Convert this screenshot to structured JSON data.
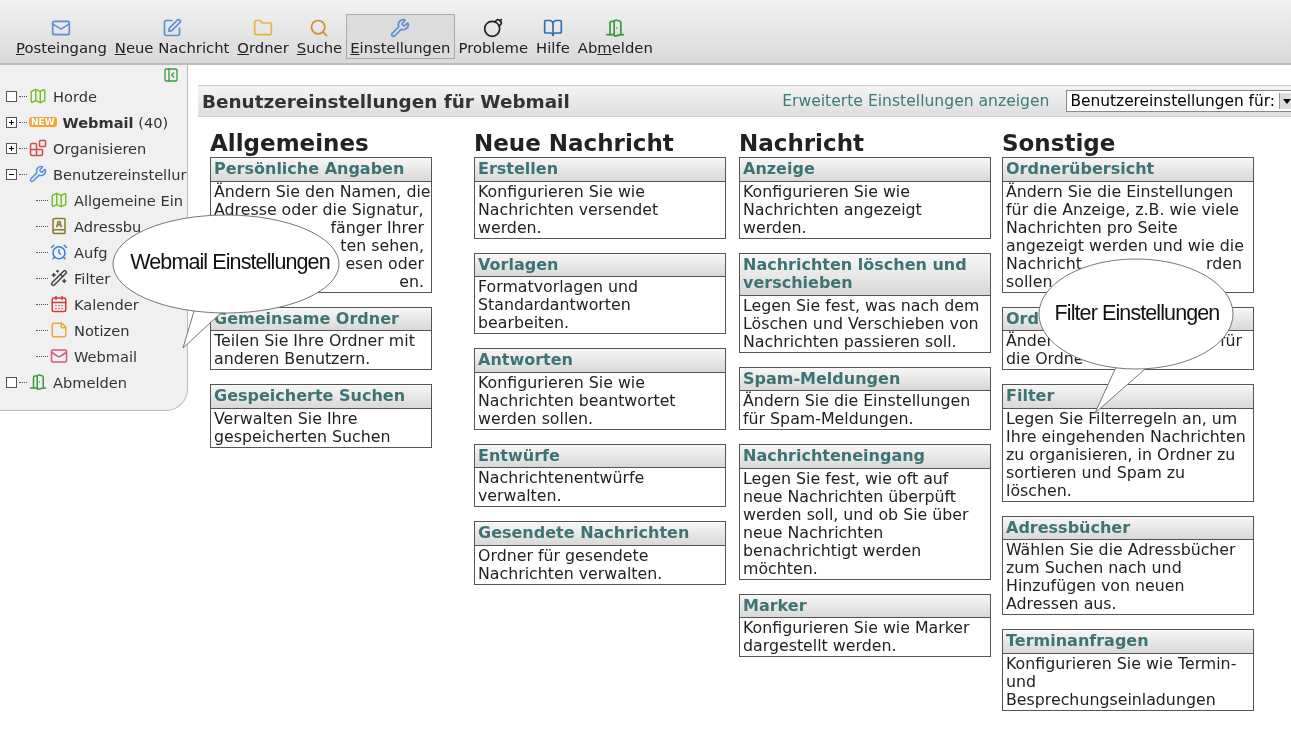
{
  "toolbar": [
    {
      "key": "P",
      "after": "osteingang",
      "selected": false
    },
    {
      "key": "N",
      "after": "eue Nachricht",
      "selected": false
    },
    {
      "key": "O",
      "after": "rdner",
      "selected": false
    },
    {
      "key": "S",
      "after": "uche",
      "selected": false
    },
    {
      "key": "E",
      "after": "instellungen",
      "selected": true
    },
    {
      "before": "Probleme",
      "selected": false
    },
    {
      "before": "Hilfe",
      "selected": false
    },
    {
      "before": "Ab",
      "key": "m",
      "after": "elden",
      "selected": false
    }
  ],
  "sidebar": {
    "items": [
      {
        "label": "Horde",
        "kind": "leaf"
      },
      {
        "badge": "NEW",
        "label": "**Webmail** (40)",
        "kind": "folder",
        "expanded": false
      },
      {
        "label": "Organisieren",
        "kind": "folder",
        "expanded": false
      },
      {
        "label": "Benutzereinstellur",
        "kind": "folder",
        "expanded": true,
        "children": [
          {
            "label": "Allgemeine Ein"
          },
          {
            "label": "Adressbu"
          },
          {
            "label": "Aufg"
          },
          {
            "label": "Filter"
          },
          {
            "label": "Kalender"
          },
          {
            "label": "Notizen"
          },
          {
            "label": "Webmail"
          }
        ]
      },
      {
        "label": "Abmelden",
        "kind": "leaf"
      }
    ]
  },
  "header": {
    "title": "Benutzereinstellungen für Webmail",
    "link": "Erweiterte Einstellungen anzeigen",
    "select": "Benutzereinstellungen für:"
  },
  "columns": [
    {
      "heading": "Allgemeines",
      "boxes": [
        {
          "title": "Persönliche Angaben",
          "lines": [
            {
              "left": "Ändern Sie den Namen, die"
            },
            {
              "left": "Adresse oder die Signatur,"
            },
            {
              "right": "fänger Ihrer"
            },
            {
              "right": "ten sehen,"
            },
            {
              "right": "esen oder"
            },
            {
              "right": "en."
            }
          ]
        },
        {
          "title": "Gemeinsame Ordner",
          "body": "Teilen Sie Ihre Ordner mit anderen Benutzern."
        },
        {
          "title": "Gespeicherte Suchen",
          "body": "Verwalten Sie Ihre gespeicherten Suchen"
        }
      ]
    },
    {
      "heading": "Neue Nachricht",
      "boxes": [
        {
          "title": "Erstellen",
          "body": "Konfigurieren Sie wie Nachrichten versendet werden."
        },
        {
          "title": "Vorlagen",
          "body": "Formatvorlagen und Standardantworten bearbeiten."
        },
        {
          "title": "Antworten",
          "body": "Konfigurieren Sie wie Nachrichten beantwortet werden sollen."
        },
        {
          "title": "Entwürfe",
          "body": "Nachrichtenentwürfe verwalten."
        },
        {
          "title": "Gesendete Nachrichten",
          "body": "Ordner für gesendete Nachrichten verwalten."
        }
      ]
    },
    {
      "heading": "Nachricht",
      "boxes": [
        {
          "title": "Anzeige",
          "body": "Konfigurieren Sie wie Nachrichten angezeigt werden."
        },
        {
          "title": "Nachrichten löschen und verschieben",
          "body": "Legen Sie fest, was nach dem Löschen und Verschieben von Nachrichten passieren soll."
        },
        {
          "title": "Spam-Meldungen",
          "body": "Ändern Sie die Einstellungen für Spam-Meldungen."
        },
        {
          "title": "Nachrichteneingang",
          "body": "Legen Sie fest, wie oft auf neue Nachrichten überpüft werden soll, und ob Sie über neue Nachrichten benachrichtigt werden möchten."
        },
        {
          "title": "Marker",
          "body": "Konfigurieren Sie wie Marker dargestellt werden."
        }
      ]
    },
    {
      "heading": "Sonstige",
      "boxes": [
        {
          "title": "Ordnerübersicht",
          "lines": [
            {
              "left": "Ändern Sie die Einstellungen"
            },
            {
              "left": "für die Anzeige, z.B. wie viele"
            },
            {
              "left": "Nachrichten pro Seite"
            },
            {
              "left": "angezeigt werden und wie die"
            },
            {
              "left": "Nachricht",
              "right": "rden"
            },
            {
              "left": "sollen"
            }
          ]
        },
        {
          "title": "Ord",
          "lines": [
            {
              "left": "Änder",
              "right": "für"
            },
            {
              "left": "die Ordne"
            }
          ]
        },
        {
          "title": "Filter",
          "body": "Legen Sie Filterregeln an, um Ihre eingehenden Nachrichten zu organisieren, in Ordner zu sortieren und Spam zu löschen."
        },
        {
          "title": "Adressbücher",
          "body": "Wählen Sie die Adressbücher zum Suchen nach und Hinzufügen von neuen Adressen aus."
        },
        {
          "title": "Terminanfragen",
          "body": "Konfigurieren Sie wie Termin- und Besprechungseinladungen"
        }
      ]
    }
  ],
  "callouts": [
    {
      "text": "Webmail Einstellungen"
    },
    {
      "text": "Filter Einstellungen"
    }
  ]
}
